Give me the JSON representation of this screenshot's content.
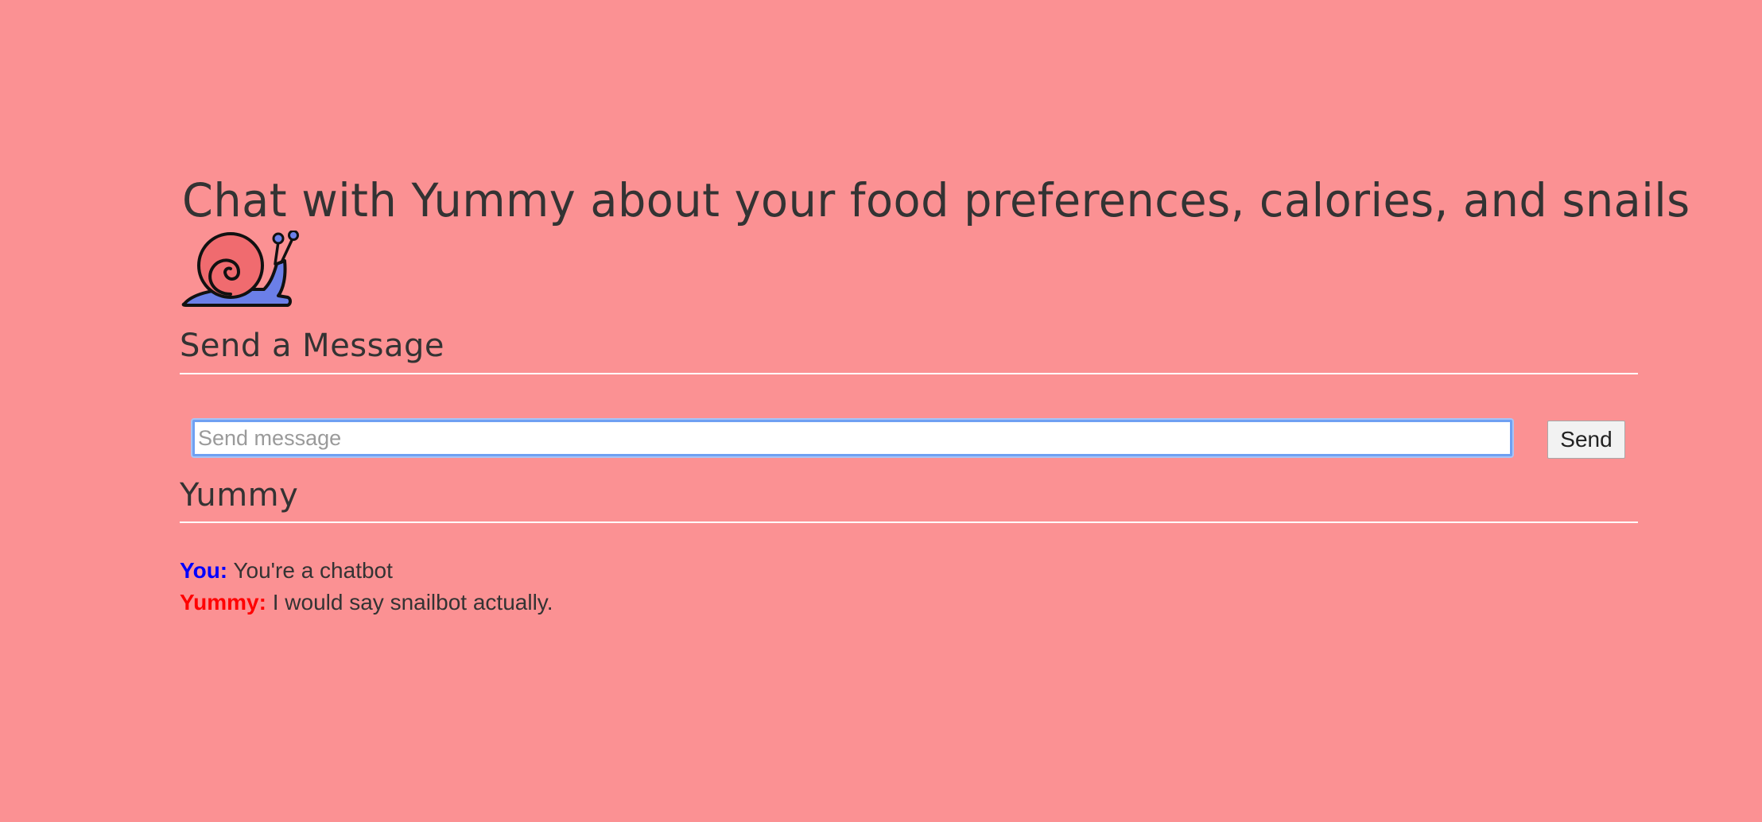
{
  "header": {
    "title": "Chat with Yummy about your food preferences, calories, and snails",
    "logo_icon": "snail-icon"
  },
  "send_section": {
    "title": "Send a Message",
    "input_value": "",
    "input_placeholder": "Send message",
    "send_label": "Send"
  },
  "chat_section": {
    "title": "Yummy",
    "messages": [
      {
        "speaker": "You:",
        "text": "You're a chatbot",
        "color": "#0000ff"
      },
      {
        "speaker": "Yummy:",
        "text": "I would say snailbot actually.",
        "color": "#ff0000"
      }
    ]
  },
  "colors": {
    "background": "#fb9193",
    "snail_shell": "#f06b6f",
    "snail_body": "#6b7fe8",
    "focus_ring": "#6fa0f2"
  }
}
